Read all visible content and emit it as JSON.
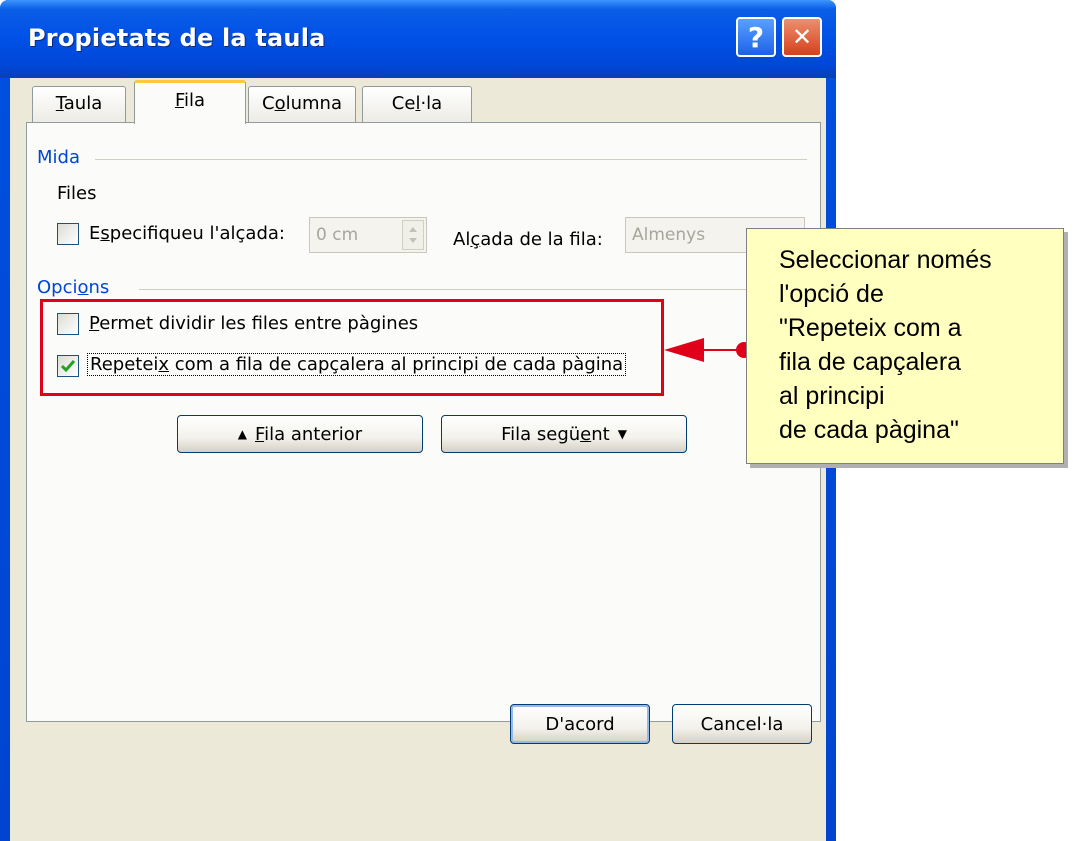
{
  "window": {
    "title": "Propietats de la taula",
    "help_glyph": "?",
    "close_glyph": "✕"
  },
  "tabs": [
    {
      "label": "Taula",
      "mnemonic": "T",
      "rest": "aula",
      "active": false
    },
    {
      "label": "Fila",
      "mnemonic": "F",
      "rest": "ila",
      "active": true
    },
    {
      "label": "Columna",
      "pre": "C",
      "mnemonic": "o",
      "rest": "lumna",
      "active": false
    },
    {
      "label": "Cel·la",
      "pre": "Ce",
      "mnemonic": "l",
      "rest": "·la",
      "active": false
    }
  ],
  "size_group": {
    "label": "Mida",
    "rows_label": "Files",
    "specify_height": {
      "pre": "E",
      "mnemonic": "s",
      "rest": "pecifiqueu l'alçada:",
      "checked": false,
      "value": "0 cm"
    },
    "row_height": {
      "pre": "Al",
      "mnemonic": "ç",
      "rest": "ada de la fila:",
      "value": "Almenys"
    }
  },
  "options_group": {
    "pre": "Opci",
    "mnemonic": "o",
    "rest": "ns",
    "allow_split": {
      "mnemonic": "P",
      "rest": "ermet dividir les files entre pàgines",
      "checked": false
    },
    "repeat_header": {
      "pre": "Repetei",
      "mnemonic": "x",
      "rest": " com a fila de capçalera al principi de cada pàgina",
      "checked": true
    }
  },
  "nav_buttons": {
    "previous": {
      "arrow": "▲",
      "mnemonic": "F",
      "rest": "ila anterior"
    },
    "next": {
      "pre": "Fila segü",
      "mnemonic": "e",
      "rest": "nt",
      "arrow": "▼"
    }
  },
  "footer": {
    "ok_label": "D'acord",
    "cancel_label": "Cancel·la"
  },
  "callout": {
    "text": "Seleccionar només\nl'opció de\n\"Repeteix com a\nfila de capçalera\nal principi\nde cada pàgina\""
  },
  "colors": {
    "titlebar": "#0050e6",
    "dialog_bg": "#ece9d8",
    "group_label": "#0046d5",
    "highlight": "#e1001a",
    "callout_bg": "#ffffc0",
    "active_tab_accent": "#ffc83c"
  }
}
